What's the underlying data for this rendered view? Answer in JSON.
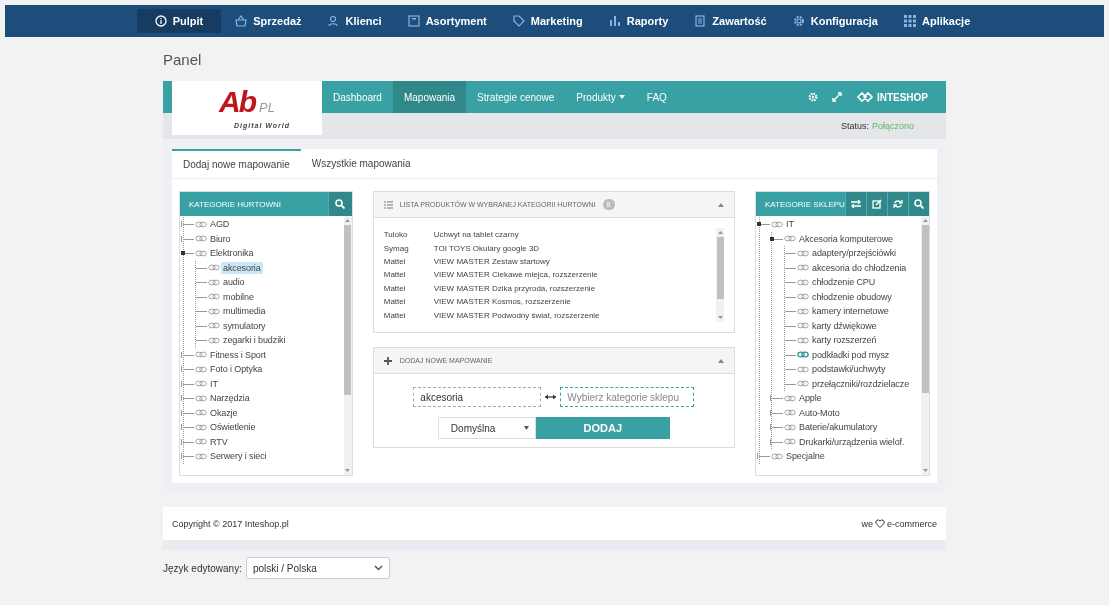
{
  "top_nav": [
    {
      "label": "Pulpit",
      "selected": true
    },
    {
      "label": "Sprzedaż",
      "selected": false
    },
    {
      "label": "Klienci",
      "selected": false
    },
    {
      "label": "Asortyment",
      "selected": false
    },
    {
      "label": "Marketing",
      "selected": false
    },
    {
      "label": "Raporty",
      "selected": false
    },
    {
      "label": "Zawartość",
      "selected": false
    },
    {
      "label": "Konfiguracja",
      "selected": false
    },
    {
      "label": "Aplikacje",
      "selected": false
    }
  ],
  "page_title": "Panel",
  "plugin": {
    "logo": {
      "main": "Ab",
      "suffix": "PL",
      "tagline": "Digital World"
    },
    "menu": [
      {
        "label": "Dashboard",
        "selected": false,
        "dropdown": false
      },
      {
        "label": "Mapowania",
        "selected": true,
        "dropdown": false
      },
      {
        "label": "Strategie cenowe",
        "selected": false,
        "dropdown": false
      },
      {
        "label": "Produkty",
        "selected": false,
        "dropdown": true
      },
      {
        "label": "FAQ",
        "selected": false,
        "dropdown": false
      }
    ],
    "brand": "INTESHOP",
    "status_label": "Status:",
    "status_value": "Połączono"
  },
  "tabs": [
    {
      "label": "Dodaj nowe mapowanie",
      "selected": true
    },
    {
      "label": "Wszystkie mapowania",
      "selected": false
    }
  ],
  "wholesale_categories": {
    "title": "KATEGORIE HURTOWNI",
    "nodes": [
      {
        "label": "AGD",
        "selected": false,
        "expanded": false
      },
      {
        "label": "Biuro",
        "selected": false,
        "expanded": false
      },
      {
        "label": "Elektronika",
        "selected": false,
        "expanded": true,
        "children": [
          {
            "label": "akcesoria",
            "selected": true
          },
          {
            "label": "audio",
            "selected": false
          },
          {
            "label": "mobilne",
            "selected": false
          },
          {
            "label": "multimedia",
            "selected": false
          },
          {
            "label": "symulatory",
            "selected": false
          },
          {
            "label": "zegarki i budziki",
            "selected": false
          }
        ]
      },
      {
        "label": "Fitness i Sport",
        "selected": false,
        "expanded": false
      },
      {
        "label": "Foto i Optyka",
        "selected": false,
        "expanded": false
      },
      {
        "label": "IT",
        "selected": false,
        "expanded": false
      },
      {
        "label": "Narzędzia",
        "selected": false,
        "expanded": false
      },
      {
        "label": "Okazje",
        "selected": false,
        "expanded": false
      },
      {
        "label": "Oświetlenie",
        "selected": false,
        "expanded": false
      },
      {
        "label": "RTV",
        "selected": false,
        "expanded": false
      },
      {
        "label": "Serwery i sieci",
        "selected": false,
        "expanded": false
      }
    ]
  },
  "products": {
    "title": "LISTA PRODUKTÓW W WYBRANEJ KATEGORII HURTOWNI",
    "count": "8",
    "rows": [
      {
        "brand": "Tuloko",
        "name": "Uchwyt na tablet czarny"
      },
      {
        "brand": "Symag",
        "name": "TOI TOYS Okulary google 3D"
      },
      {
        "brand": "Mattel",
        "name": "VIEW MASTER Zestaw startowy"
      },
      {
        "brand": "Mattel",
        "name": "VIEW MASTER Ciekawe miejca, rozszerzenie"
      },
      {
        "brand": "Mattel",
        "name": "VIEW MASTER Dzika przyroda, rozszerzenie"
      },
      {
        "brand": "Mattel",
        "name": "VIEW MASTER Kosmos, rozszerzenie"
      },
      {
        "brand": "Mattel",
        "name": "VIEW MASTER Podwodny świat, rozszerzenie"
      }
    ]
  },
  "new_mapping": {
    "title": "DODAJ NOWE MAPOWANIE",
    "source": "akcesoria",
    "target_placeholder": "Wybierz kategorie sklepu",
    "strategy": "Domyślna",
    "button": "DODAJ"
  },
  "shop_categories": {
    "title": "KATEGORIE SKLEPU",
    "nodes": [
      {
        "label": "IT",
        "linked": false,
        "expanded": true,
        "children": [
          {
            "label": "Akcesoria komputerowe",
            "linked": false,
            "expanded": true,
            "children": [
              {
                "label": "adaptery/przejściówki",
                "linked": false
              },
              {
                "label": "akcesoria do chłodzenia",
                "linked": false
              },
              {
                "label": "chłodzenie CPU",
                "linked": false
              },
              {
                "label": "chłodzenie obudowy",
                "linked": false
              },
              {
                "label": "kamery internetowe",
                "linked": false
              },
              {
                "label": "karty dźwiękowe",
                "linked": false
              },
              {
                "label": "karty rozszerzeń",
                "linked": false
              },
              {
                "label": "podkładki pod mysz",
                "linked": true
              },
              {
                "label": "podstawki/uchwyty",
                "linked": false
              },
              {
                "label": "przełączniki/rozdzielacze",
                "linked": false
              }
            ]
          },
          {
            "label": "Apple",
            "linked": false,
            "expanded": false
          },
          {
            "label": "Auto-Moto",
            "linked": false,
            "expanded": false
          },
          {
            "label": "Baterie/akumulatory",
            "linked": false,
            "expanded": false
          },
          {
            "label": "Drukarki/urządzenia wielof.",
            "linked": false,
            "expanded": false
          }
        ]
      },
      {
        "label": "Specjalne",
        "linked": false,
        "expanded": false
      }
    ]
  },
  "footer": {
    "copyright": "Copyright © 2017 Inteshop.pl",
    "tagline_before": "we",
    "tagline_after": "e-commerce"
  },
  "language": {
    "label": "Język edytowany:",
    "value": "polski / Polska"
  }
}
